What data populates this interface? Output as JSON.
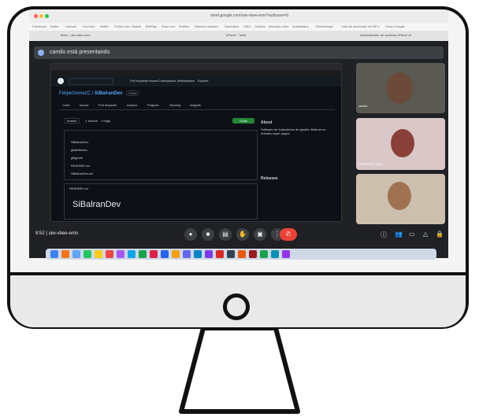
{
  "browser": {
    "url": "meet.google.com/uiw-vbee-emn?authuser=0",
    "bookmarks": [
      "Facebook",
      "Twitter",
      "Hotmail",
      "YouTube",
      "Netflix",
      "FeDez Dev",
      "Reddit",
      "BetPlay",
      "Ebox Live",
      "Emblox",
      "Sistema maestro",
      "Speedtest",
      "SIAG",
      "Confero",
      "Mercado Libre",
      "Actividades",
      "Remesheap",
      "Lista de ascensión de GPU",
      "Curso Google"
    ],
    "tabs": [
      "Meet - uiw-vbee-emn",
      "oPanel - Tools",
      "Administrador de archivos cPanel v3"
    ]
  },
  "meet": {
    "presenting_text": "camilo está presentando",
    "meeting_code": "8:52 | uiw-vbee-emn",
    "participants": [
      "camilo",
      "FRIEDFIVE DIAZ",
      ""
    ]
  },
  "github": {
    "repo_owner": "FelipeGomezC",
    "repo_name": "SiBalranDev",
    "visibility": "Public",
    "tabs": [
      "Code",
      "Issues",
      "Pull requests",
      "Actions",
      "Projects",
      "Security",
      "Insights"
    ],
    "branch": "master",
    "branches": "1 branch",
    "tags": "0 tags",
    "files": [
      "SiBalranDev",
      "gitattributes",
      "gitignore",
      "README.md",
      "SiBalranDev.sln"
    ],
    "about_title": "About",
    "about_text": "Software de indicadores de gestión Balkran en entrada super pages",
    "readme_title": "README.md",
    "readme_heading": "SiBalranDev",
    "releases": "Releases",
    "nav": [
      "Pull requests",
      "Issues",
      "Codespaces",
      "Marketplace",
      "Explore"
    ]
  },
  "colors": {
    "meet_bg": "#202124",
    "end_call": "#ea4335",
    "github_bg": "#0d1117",
    "github_link": "#58a6ff",
    "green_button": "#238636"
  }
}
